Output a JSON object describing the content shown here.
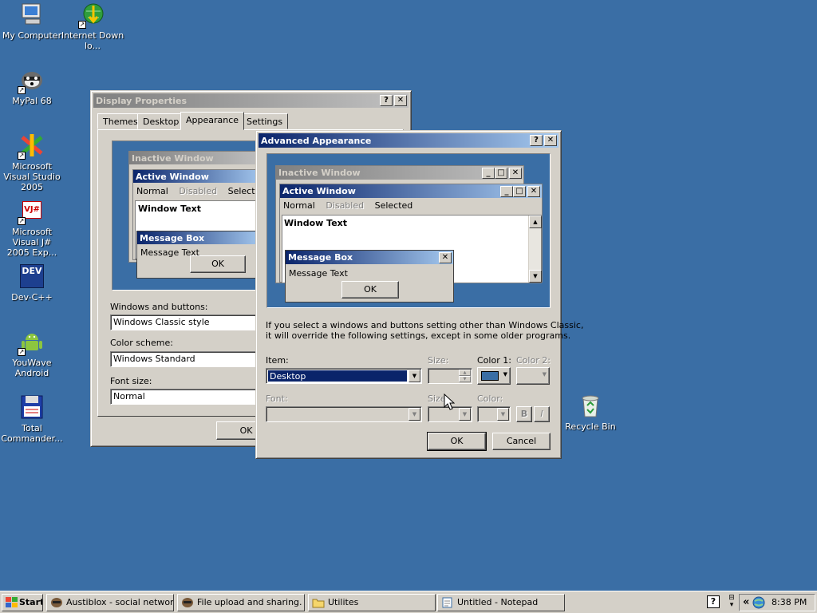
{
  "desktop": {
    "icons": [
      {
        "label": "My Computer"
      },
      {
        "label": "Internet Downlo..."
      },
      {
        "label": "MyPal 68"
      },
      {
        "label": "Microsoft Visual Studio 2005"
      },
      {
        "label": "Microsoft Visual J# 2005 Exp..."
      },
      {
        "label": "Dev-C++"
      },
      {
        "label": "YouWave Android"
      },
      {
        "label": "Total Commander..."
      },
      {
        "label": "Recycle Bin"
      }
    ],
    "devcpp_badge": "DEV",
    "vj_badge": "VJ#"
  },
  "display_props": {
    "title": "Display Properties",
    "help": "?",
    "close": "✕",
    "tabs": [
      "Themes",
      "Desktop",
      "Appearance",
      "Settings"
    ],
    "preview": {
      "inactive_title": "Inactive Window",
      "active_title": "Active Window",
      "menu": [
        "Normal",
        "Disabled",
        "Selected"
      ],
      "window_text": "Window Text",
      "msgbox_title": "Message Box",
      "msgbox_text": "Message Text",
      "ok": "OK"
    },
    "windows_buttons_label": "Windows and buttons:",
    "windows_buttons_value": "Windows Classic style",
    "color_scheme_label": "Color scheme:",
    "color_scheme_value": "Windows Standard",
    "font_size_label": "Font size:",
    "font_size_value": "Normal",
    "ok": "OK"
  },
  "advanced": {
    "title": "Advanced Appearance",
    "help": "?",
    "close": "✕",
    "preview": {
      "inactive_title": "Inactive Window",
      "active_title": "Active Window",
      "menu": [
        "Normal",
        "Disabled",
        "Selected"
      ],
      "window_text": "Window Text",
      "msgbox_title": "Message Box",
      "msgbox_text": "Message Text",
      "ok": "OK"
    },
    "info_line1": "If you select a windows and buttons setting other than Windows Classic,",
    "info_line2": "it will override the following settings, except in some older programs.",
    "item_label": "Item:",
    "item_value": "Desktop",
    "size_label": "Size:",
    "color1_label": "Color 1:",
    "color2_label": "Color 2:",
    "font_label": "Font:",
    "size2_label": "Size:",
    "color_label": "Color:",
    "bold": "B",
    "italic": "I",
    "ok": "OK",
    "cancel": "Cancel",
    "color1_swatch": "#3a6ea5"
  },
  "taskbar": {
    "start": "Start",
    "buttons": [
      {
        "label": "Austiblox - social networ..."
      },
      {
        "label": "File upload and sharing. ..."
      },
      {
        "label": "Utilites"
      },
      {
        "label": "Untitled - Notepad"
      }
    ],
    "tray_chevron": "«",
    "clock": "8:38 PM"
  }
}
